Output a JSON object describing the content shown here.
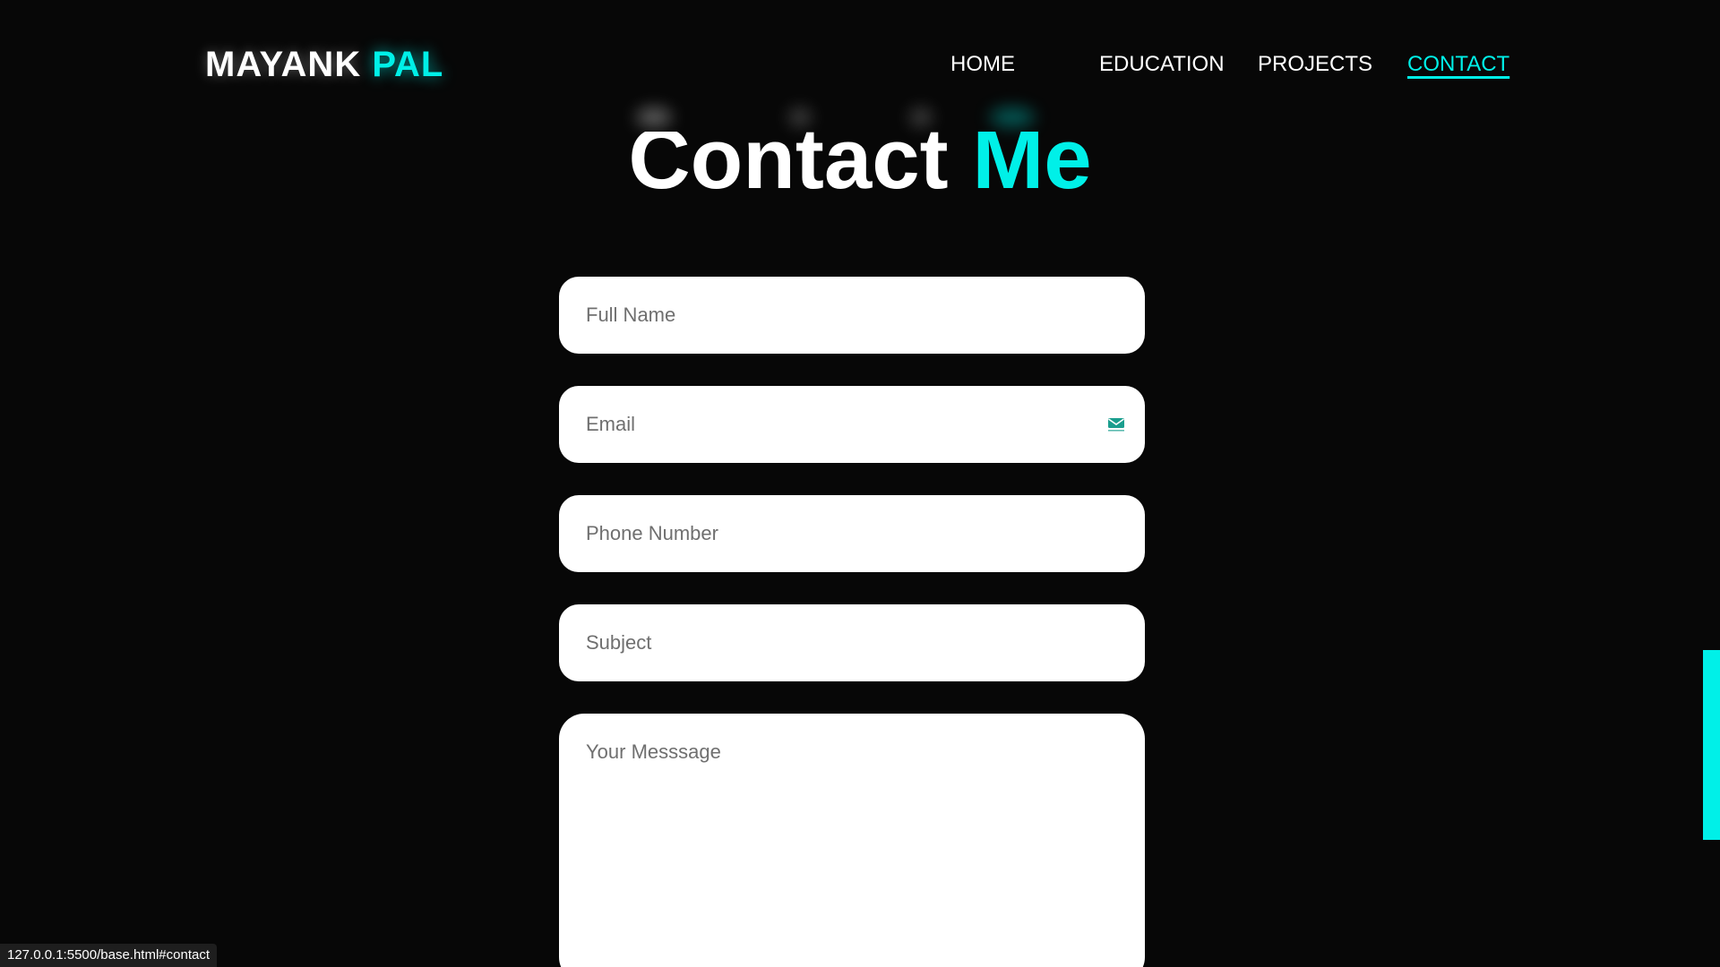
{
  "header": {
    "logo_first": "MAYANK",
    "logo_second": "PAL",
    "nav": [
      {
        "label": "HOME"
      },
      {
        "label": "EDUCATION"
      },
      {
        "label": "PROJECTS"
      },
      {
        "label": "CONTACT",
        "active": true
      }
    ]
  },
  "section": {
    "title_first": "Contact",
    "title_second": "Me"
  },
  "form": {
    "full_name_placeholder": "Full Name",
    "email_placeholder": "Email",
    "phone_placeholder": "Phone Number",
    "subject_placeholder": "Subject",
    "message_placeholder": "Your Messsage"
  },
  "icons": {
    "email_field_icon": "envelope-icon"
  },
  "status_bar": {
    "url": "127.0.0.1:5500/base.html#contact"
  },
  "colors": {
    "background": "#070707",
    "accent": "#00f0e8",
    "field_bg": "#ffffff"
  }
}
